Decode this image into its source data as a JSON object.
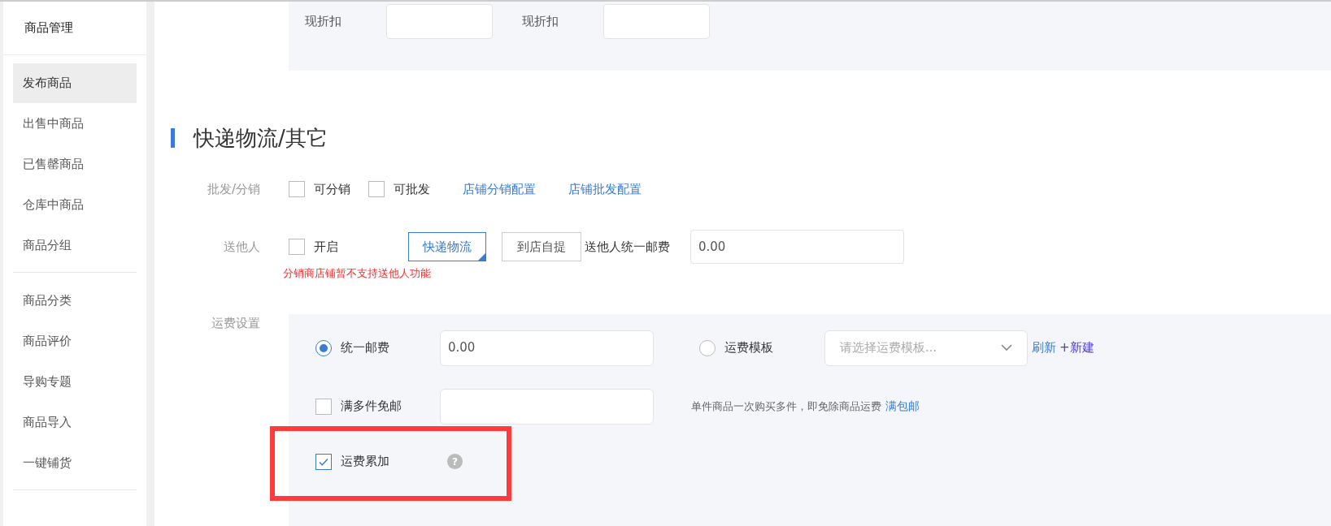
{
  "sidebar": {
    "title": "商品管理",
    "groups": [
      {
        "items": [
          {
            "label": "发布商品",
            "selected": true
          },
          {
            "label": "出售中商品",
            "selected": false
          },
          {
            "label": "已售罄商品",
            "selected": false
          },
          {
            "label": "仓库中商品",
            "selected": false
          },
          {
            "label": "商品分组",
            "selected": false
          }
        ]
      },
      {
        "items": [
          {
            "label": "商品分类",
            "selected": false
          },
          {
            "label": "商品评价",
            "selected": false
          },
          {
            "label": "导购专题",
            "selected": false
          },
          {
            "label": "商品导入",
            "selected": false
          },
          {
            "label": "一键铺货",
            "selected": false
          }
        ]
      }
    ]
  },
  "discount_panel": {
    "fields": [
      {
        "label": "现折扣"
      },
      {
        "label": "现折扣"
      }
    ]
  },
  "section": {
    "title": "快递物流/其它"
  },
  "wholesale": {
    "label": "批发/分销",
    "options": [
      {
        "label": "可分销",
        "checked": false
      },
      {
        "label": "可批发",
        "checked": false
      }
    ],
    "links": [
      "店铺分销配置",
      "店铺批发配置"
    ]
  },
  "gift": {
    "label": "送他人",
    "enable": {
      "label": "开启",
      "checked": false
    },
    "modes": [
      {
        "label": "快递物流",
        "selected": true
      },
      {
        "label": "到店自提",
        "selected": false
      }
    ],
    "fee_label": "送他人统一邮费",
    "fee_value": "0.00",
    "warning": "分销商店铺暂不支持送他人功能"
  },
  "shipping": {
    "label": "运费设置",
    "uniform": {
      "label": "统一邮费",
      "selected": true,
      "value": "0.00"
    },
    "template": {
      "label": "运费模板",
      "selected": false,
      "placeholder": "请选择运费模板...",
      "links": [
        "刷新",
        "+新建"
      ]
    },
    "free_multi": {
      "label": "满多件免邮",
      "checked": false,
      "hint": "单件商品一次购买多件，即免除商品运费",
      "link": "满包邮"
    },
    "accumulate": {
      "label": "运费累加",
      "checked": true,
      "help": "?",
      "highlighted": true
    }
  }
}
